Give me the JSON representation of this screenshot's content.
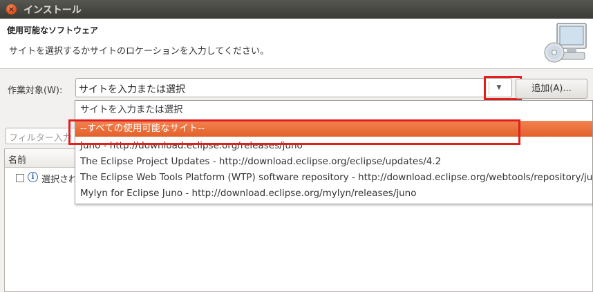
{
  "window": {
    "title": "インストール",
    "close_glyph": "×"
  },
  "header": {
    "title": "使用可能なソフトウェア",
    "description": "サイトを選択するかサイトのロケーションを入力してください。",
    "image_icon": "monitor-cd-icon"
  },
  "work_with": {
    "label": "作業対象(W):",
    "value": "サイトを入力または選択",
    "arrow_glyph": "▼",
    "add_button_label": "追加(A)..."
  },
  "filter": {
    "placeholder": "フィルター入力"
  },
  "table": {
    "column_name": "名前",
    "rows": [
      {
        "checked": false,
        "icon": "info-icon",
        "text": "選択されたサイトにはアイテムが存在しません"
      }
    ]
  },
  "dropdown": {
    "items": [
      "サイトを入力または選択",
      "--すべての使用可能なサイト--",
      "Juno - http://download.eclipse.org/releases/juno",
      "The Eclipse Project Updates - http://download.eclipse.org/eclipse/updates/4.2",
      "The Eclipse Web Tools Platform (WTP) software repository - http://download.eclipse.org/webtools/repository/juno",
      "Mylyn for Eclipse Juno - http://download.eclipse.org/mylyn/releases/juno"
    ],
    "selected_index": 1
  },
  "colors": {
    "titlebar": "#3c3b37",
    "selection": "#e3602a",
    "highlight": "#e11f1f",
    "close_button": "#df4a16"
  }
}
